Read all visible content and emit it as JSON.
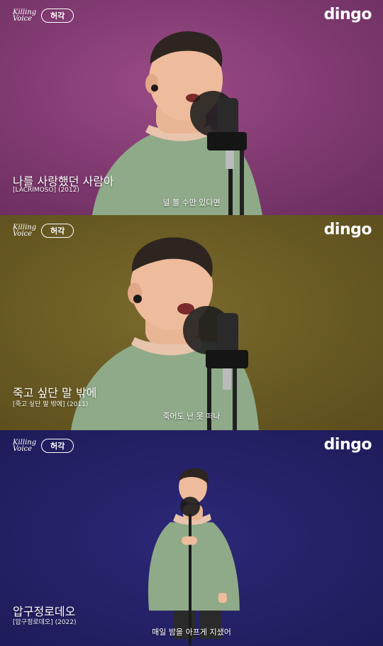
{
  "brand": {
    "kv_mark": "Killing Voice",
    "artist": "허각",
    "dingo": "dingo"
  },
  "panels": [
    {
      "title": "나를 사랑했던 사람아",
      "subtitle": "[LACRIMOSO] (2012)",
      "lyric": "널 볼 수만 있다면",
      "bg": "#7e3a6e"
    },
    {
      "title": "죽고 싶단 말 밖에",
      "subtitle": "[죽고 싶단 말 밖에] (2011)",
      "lyric": "죽어도 난 못 떠나",
      "bg": "#6a5a22"
    },
    {
      "title": "압구정로데오",
      "subtitle": "[압구정로데오] (2022)",
      "lyric": "매일 밤을 아프게 지샜어",
      "bg": "#231f66"
    }
  ]
}
